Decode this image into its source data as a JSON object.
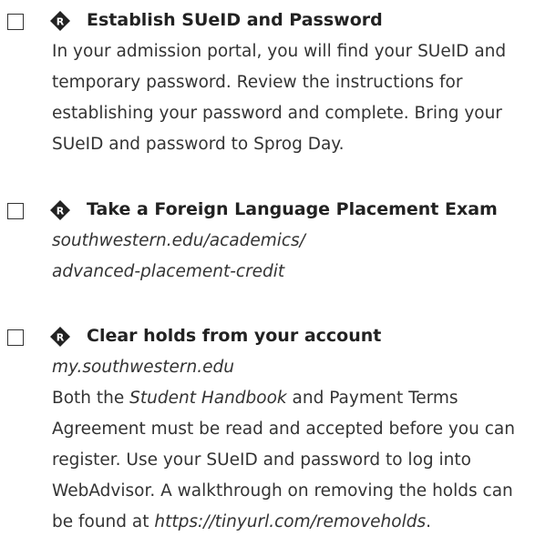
{
  "items": [
    {
      "title": "Establish SUeID and Password",
      "lines": [
        "In your admission portal, you will find your SUeID and",
        "temporary password. Review the instructions for",
        "establishing your password and complete. Bring your",
        "SUeID and password to Sprog Day."
      ]
    },
    {
      "title": "Take a Foreign Language Placement Exam",
      "lines": [
        "southwestern.edu/academics/",
        "advanced-placement-credit"
      ]
    },
    {
      "title": "Clear holds from your account",
      "link": "my.southwestern.edu",
      "line1_a": "Both the ",
      "line1_b": "Student Handbook",
      "line1_c": " and Payment Terms",
      "line2": "Agreement must be read and accepted before you can",
      "line3": "register. Use your SUeID and password to log into",
      "line4": "WebAdvisor. A walkthrough on removing the holds can",
      "line5_a": "be found at ",
      "line5_b": "https://tinyurl.com/removeholds",
      "line5_c": "."
    }
  ],
  "icon": {
    "name": "diamond-r-icon",
    "glyph": "R",
    "color": "#222222"
  }
}
